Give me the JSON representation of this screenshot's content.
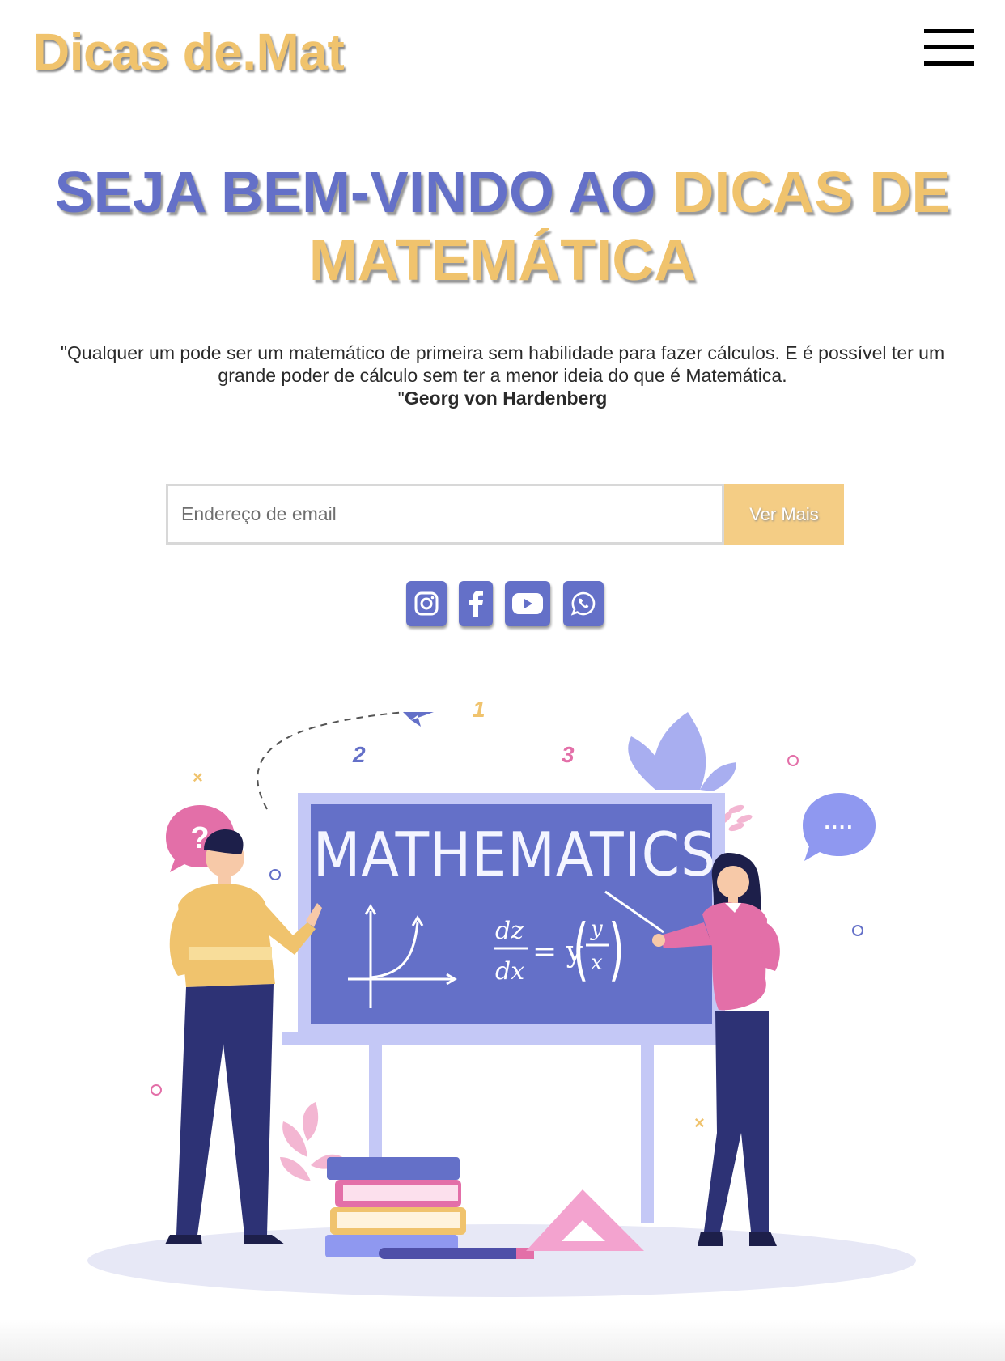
{
  "header": {
    "logo": "Dicas de.Mat",
    "menu_icon": "hamburger-menu-icon"
  },
  "hero": {
    "title_part1": "SEJA BEM-VINDO AO ",
    "title_part2": "DICAS DE MATEMÁTICA",
    "quote_text": "\"Qualquer um pode ser um matemático de primeira sem habilidade para fazer cálculos. E é possível ter um grande poder de cálculo sem ter a menor ideia do que é Matemática.",
    "quote_close": "\"",
    "quote_author": "Georg von Hardenberg"
  },
  "subscribe": {
    "placeholder": "Endereço de email",
    "button_label": "Ver Mais"
  },
  "social": [
    {
      "icon": "instagram-icon"
    },
    {
      "icon": "facebook-icon"
    },
    {
      "icon": "youtube-icon"
    },
    {
      "icon": "whatsapp-icon"
    }
  ],
  "illustration": {
    "board_text": "MATHEMATICS",
    "equation_left_top": "dz",
    "equation_left_bottom": "dx",
    "equation_mid": "= y",
    "equation_frac_top": "y",
    "equation_frac_bottom": "x",
    "number_1": "1",
    "number_2": "2",
    "number_3": "3",
    "question_mark": "?",
    "speech_dots": "....",
    "cross_mark": "×"
  },
  "colors": {
    "accent_gold": "#f0c36d",
    "accent_blue": "#6470c8",
    "pink": "#e36fa8"
  }
}
